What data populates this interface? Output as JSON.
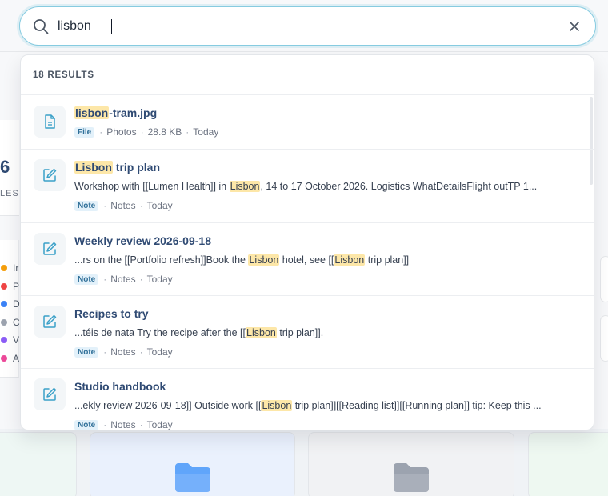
{
  "search": {
    "value": "lisbon",
    "query_term": "lisbon"
  },
  "results": {
    "count_label": "18 RESULTS",
    "items": [
      {
        "kind": "file",
        "icon": "file-icon",
        "title_parts": [
          {
            "t": "lisbon",
            "hl": true
          },
          {
            "t": "-tram.jpg",
            "hl": false
          }
        ],
        "snippet_parts": [],
        "badge": "File",
        "meta": [
          "Photos",
          "28.8 KB",
          "Today"
        ]
      },
      {
        "kind": "note",
        "icon": "edit-note-icon",
        "title_parts": [
          {
            "t": "Lisbon",
            "hl": true
          },
          {
            "t": " trip plan",
            "hl": false
          }
        ],
        "snippet_parts": [
          {
            "t": "Workshop with [[Lumen Health]] in ",
            "hl": false
          },
          {
            "t": "Lisbon",
            "hl": true
          },
          {
            "t": ", 14 to 17 October 2026. Logistics WhatDetailsFlight outTP 1...",
            "hl": false
          }
        ],
        "badge": "Note",
        "meta": [
          "Notes",
          "Today"
        ]
      },
      {
        "kind": "note",
        "icon": "edit-note-icon",
        "title_parts": [
          {
            "t": "Weekly review 2026-09-18",
            "hl": false
          }
        ],
        "snippet_parts": [
          {
            "t": "...rs on the [[Portfolio refresh]]Book the ",
            "hl": false
          },
          {
            "t": "Lisbon",
            "hl": true
          },
          {
            "t": " hotel, see [[",
            "hl": false
          },
          {
            "t": "Lisbon",
            "hl": true
          },
          {
            "t": " trip plan]]",
            "hl": false
          }
        ],
        "badge": "Note",
        "meta": [
          "Notes",
          "Today"
        ]
      },
      {
        "kind": "note",
        "icon": "edit-note-icon",
        "title_parts": [
          {
            "t": "Recipes to try",
            "hl": false
          }
        ],
        "snippet_parts": [
          {
            "t": "...téis de nata Try the recipe after the [[",
            "hl": false
          },
          {
            "t": "Lisbon",
            "hl": true
          },
          {
            "t": " trip plan]].",
            "hl": false
          }
        ],
        "badge": "Note",
        "meta": [
          "Notes",
          "Today"
        ]
      },
      {
        "kind": "note",
        "icon": "edit-note-icon",
        "title_parts": [
          {
            "t": "Studio handbook",
            "hl": false
          }
        ],
        "snippet_parts": [
          {
            "t": "...ekly review 2026-09-18]] Outside work [[",
            "hl": false
          },
          {
            "t": "Lisbon",
            "hl": true
          },
          {
            "t": " trip plan]][[Reading list]][[Running plan]] tip: Keep this ...",
            "hl": false
          }
        ],
        "badge": "Note",
        "meta": [
          "Notes",
          "Today"
        ]
      }
    ]
  },
  "background": {
    "stat_value": "6",
    "stat_label": "LES",
    "legend": [
      {
        "label": "Ir",
        "color": "#f59e0b"
      },
      {
        "label": "P",
        "color": "#ef4444"
      },
      {
        "label": "D",
        "color": "#3b82f6"
      },
      {
        "label": "C",
        "color": "#9ca3af"
      },
      {
        "label": "V",
        "color": "#8b5cf6"
      },
      {
        "label": "A",
        "color": "#ec4899"
      }
    ],
    "folders": [
      {
        "name": "folder-card-blue",
        "color": "#60a5fa"
      },
      {
        "name": "folder-card-gray",
        "color": "#9ca3af"
      }
    ]
  },
  "colors": {
    "accent": "#86cbe0",
    "highlight": "#fde7a8",
    "title": "#2f4a73",
    "badge_bg": "#e3f1fa"
  }
}
